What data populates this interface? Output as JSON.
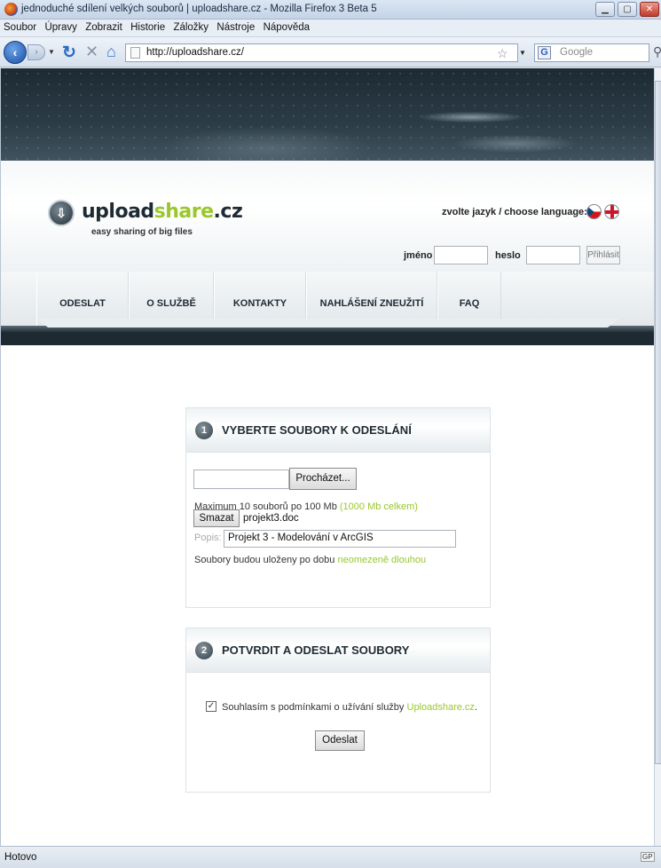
{
  "window": {
    "title": "jednoduché sdílení velkých souborů | uploadshare.cz - Mozilla Firefox 3 Beta 5",
    "controls": {
      "minimize": "▁",
      "maximize": "▢",
      "close": "✕"
    }
  },
  "menubar": {
    "items": [
      "Soubor",
      "Úpravy",
      "Zobrazit",
      "Historie",
      "Záložky",
      "Nástroje",
      "Nápověda"
    ]
  },
  "navbar": {
    "url": "http://uploadshare.cz/",
    "search_placeholder": "Google",
    "search_engine_icon": "G"
  },
  "site": {
    "logo": {
      "part1": "upload",
      "part2": "share",
      "part3": ".cz"
    },
    "tagline": "easy sharing of big files",
    "language_label": "zvolte jazyk / choose language:",
    "login": {
      "username_label": "jméno",
      "password_label": "heslo",
      "button": "Přihlásit"
    },
    "menu": [
      "ODESLAT",
      "O SLUŽBĚ",
      "KONTAKTY",
      "NAHLÁŠENÍ ZNEUŽITÍ",
      "FAQ"
    ],
    "accent_color": "#9ac72c"
  },
  "step1": {
    "number": "1",
    "title": "VYBERTE SOUBORY K ODESLÁNÍ",
    "browse_button": "Procházet...",
    "limit_text": "Maximum 10 souborů po 100 Mb",
    "limit_total": "(1000 Mb celkem)",
    "remove_button": "Smazat",
    "file_name": "projekt3.doc",
    "description_label": "Popis:",
    "description_value": "Projekt 3 - Modelování v ArcGIS",
    "storage_text": "Soubory budou uloženy po dobu",
    "storage_duration": "neomezeně dlouhou"
  },
  "step2": {
    "number": "2",
    "title": "POTVRDIT A ODESLAT SOUBORY",
    "agree_text": "Souhlasím s podmínkami o užívání služby",
    "agree_link": "Uploadshare.cz",
    "agree_end": ".",
    "checked_mark": "✓",
    "submit_button": "Odeslat"
  },
  "statusbar": {
    "text": "Hotovo",
    "icon_label": "GP"
  }
}
